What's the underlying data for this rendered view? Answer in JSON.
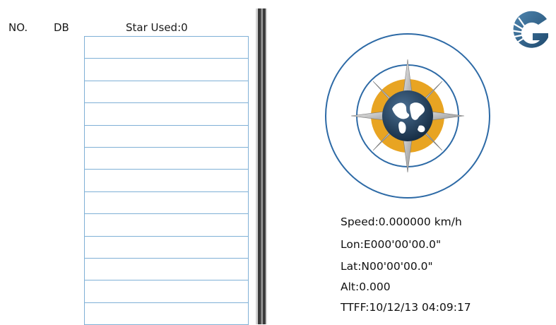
{
  "header": {
    "no_label": "NO.",
    "db_label": "DB",
    "star_used": "Star Used:0"
  },
  "satellite_table": {
    "row_count": 13
  },
  "info": {
    "speed": "Speed:0.000000 km/h",
    "lon": "Lon:E000'00'00.0\"",
    "lat": "Lat:N00'00'00.0\"",
    "alt": "Alt:0.000",
    "ttff": "TTFF:10/12/13 04:09:17"
  },
  "colors": {
    "table_border": "#7fb0d6",
    "compass_ring": "#2d6aa6",
    "compass_gold": "#e8a422",
    "globe_navy": "#1c3550",
    "logo_blue": "#2f5f86"
  },
  "icons": {
    "logo": "g-logo-icon",
    "compass": "compass-globe-icon"
  }
}
